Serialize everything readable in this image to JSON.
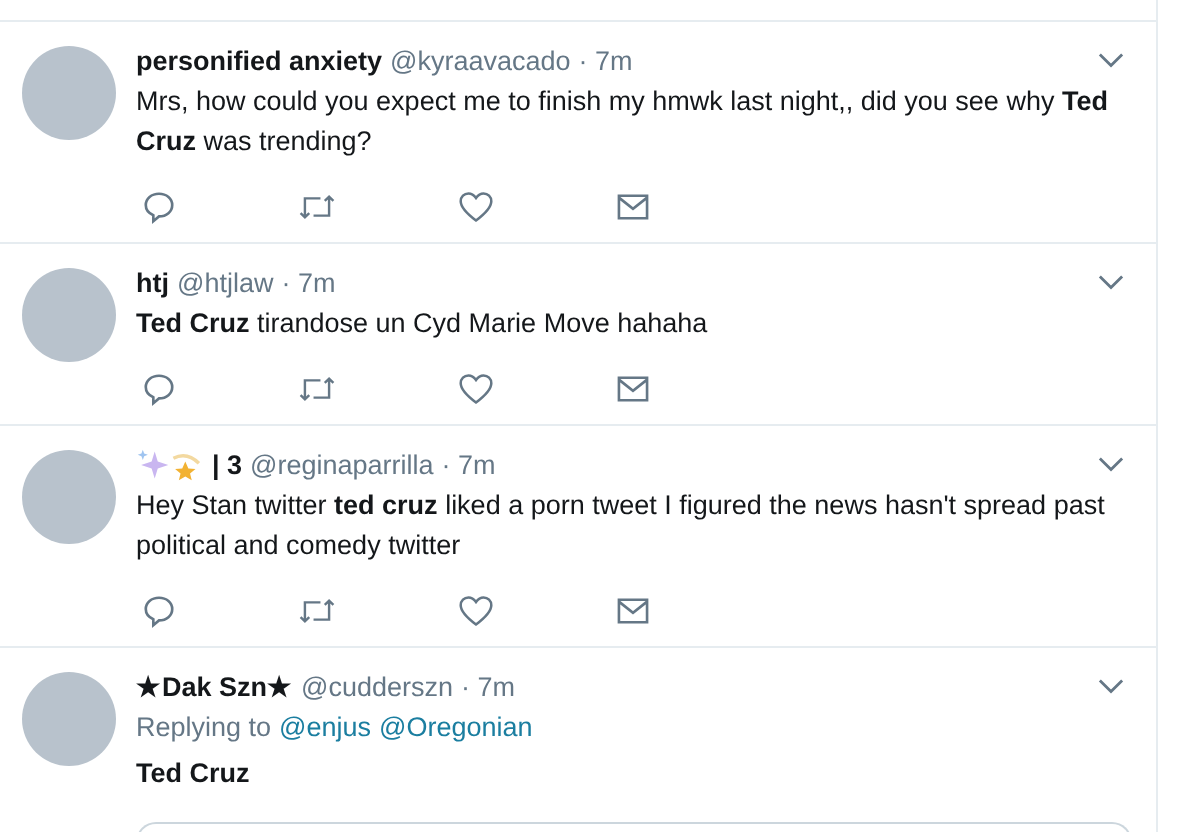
{
  "tweets": [
    {
      "name": "personified anxiety",
      "handle": "@kyraavacado",
      "time": "· 7m",
      "text": "Mrs, how could you expect me to finish my hmwk last night,, did you see why **Ted Cruz** was trending?"
    },
    {
      "name": "htj",
      "handle": "@htjlaw",
      "time": "· 7m",
      "text": "**Ted Cruz** tirandose un Cyd Marie Move hahaha"
    },
    {
      "name": "| 3",
      "name_emoji": true,
      "handle": "@reginaparrilla",
      "time": "· 7m",
      "text": "Hey Stan twitter **ted cruz** liked a porn tweet I figured the news hasn't spread past political and comedy twitter"
    },
    {
      "name": "★Dak Szn★",
      "handle": "@cudderszn",
      "time": "· 7m",
      "replying_to": {
        "label": "Replying to",
        "handles": [
          "@enjus",
          "@Oregonian"
        ]
      },
      "text": "Ted Cruz",
      "text_bold": true,
      "quoted_card": true
    }
  ]
}
